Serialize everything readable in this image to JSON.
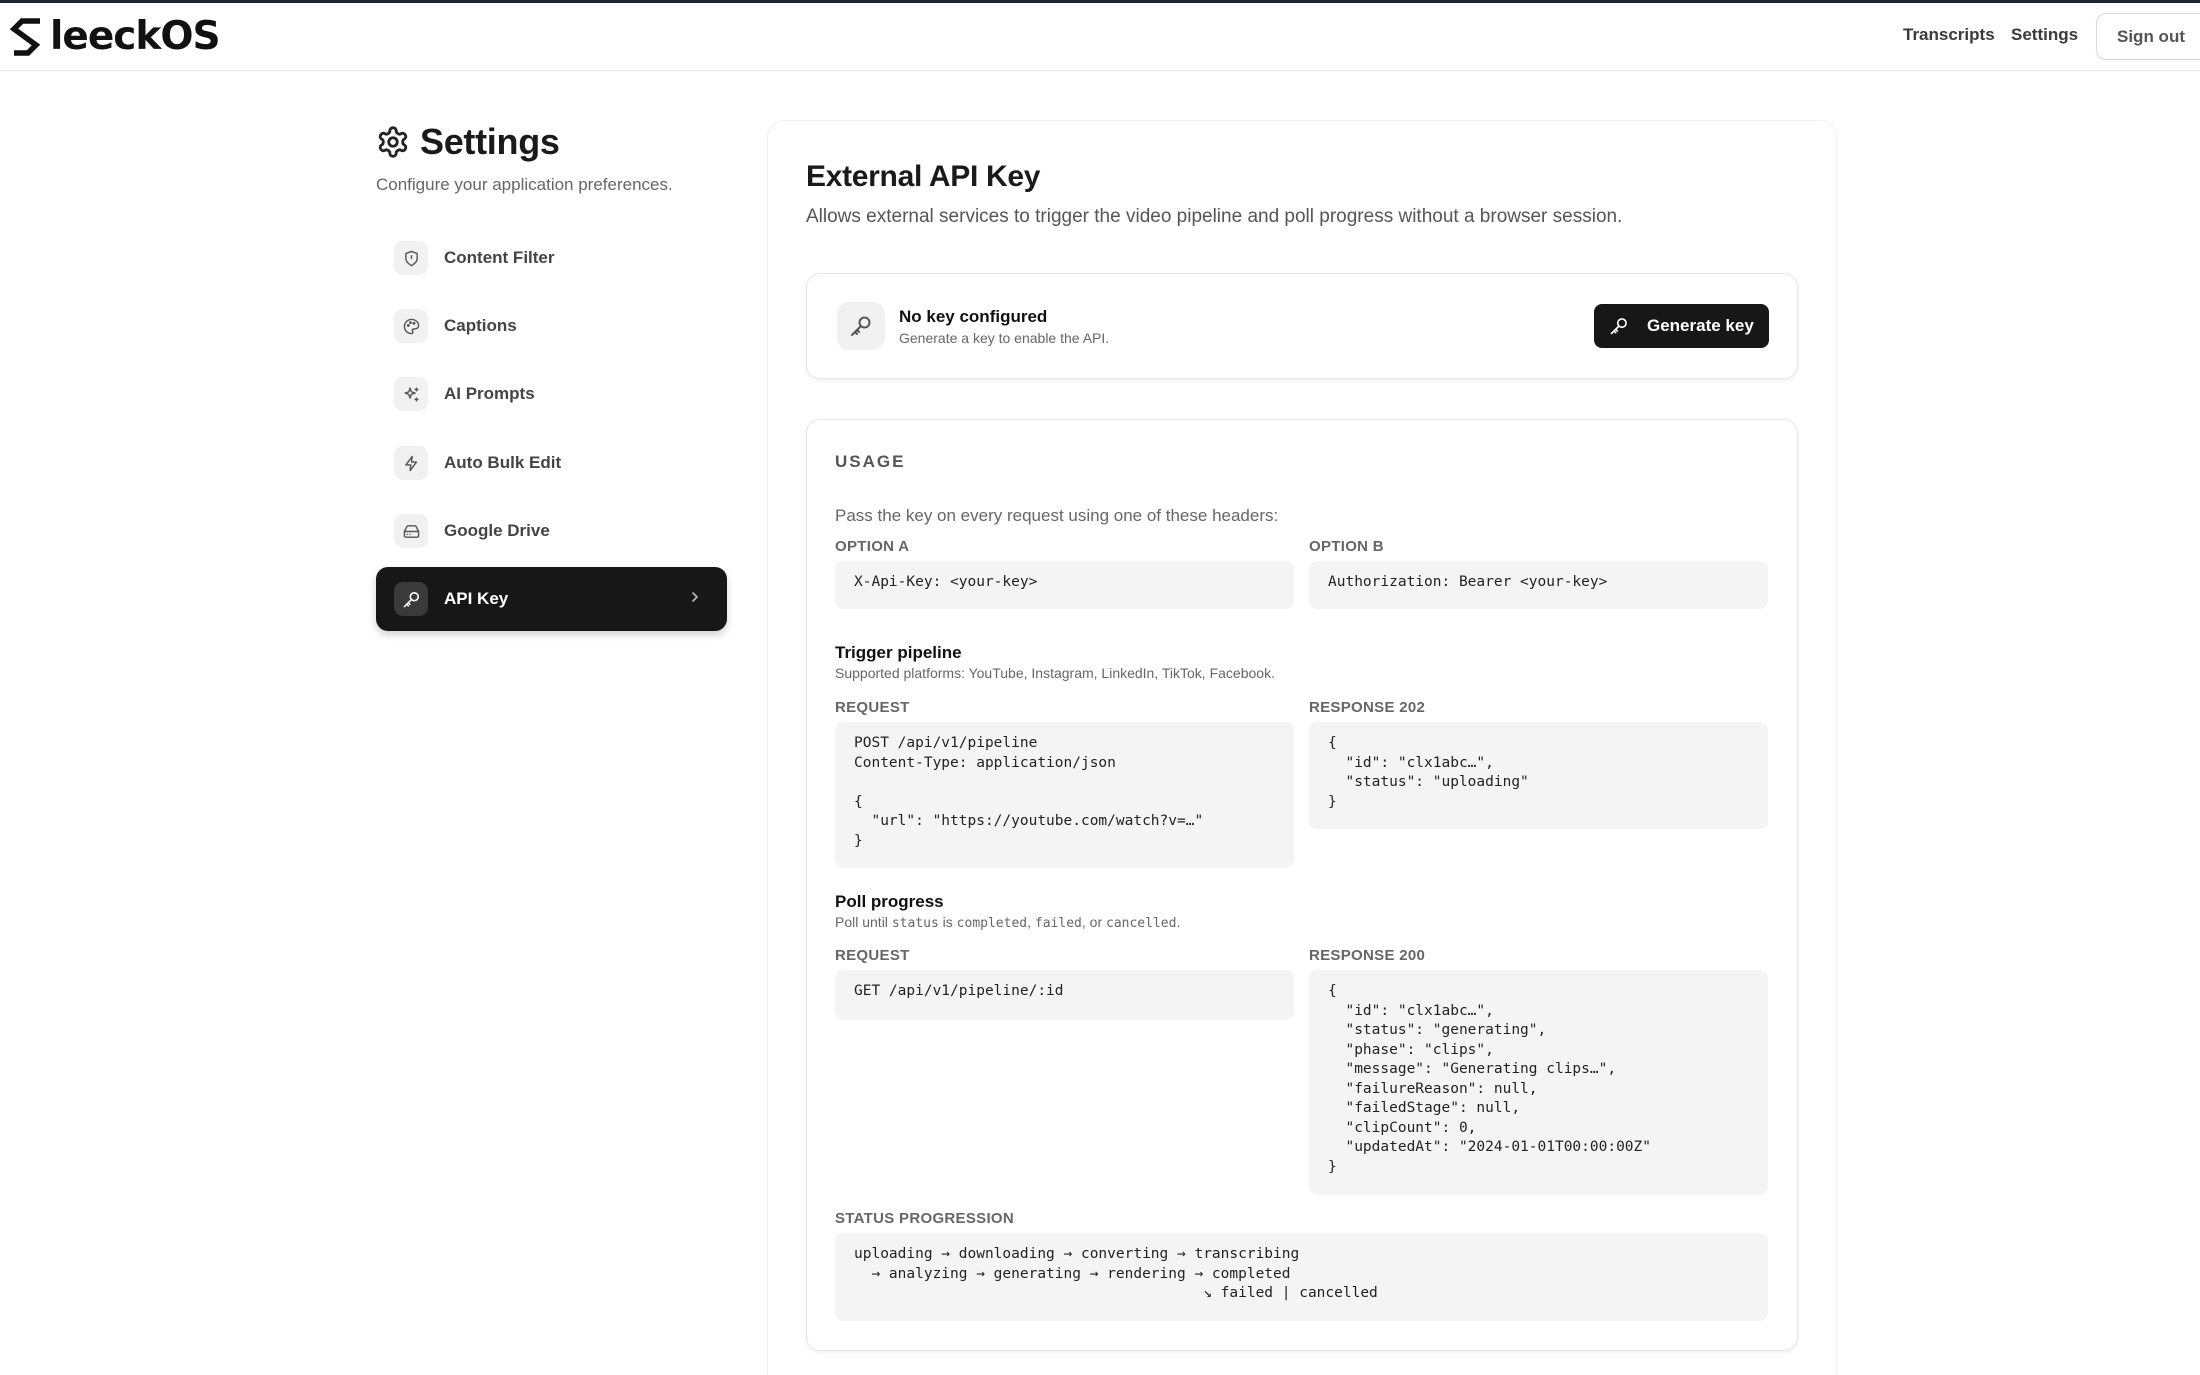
{
  "brand": {
    "logo_text": "leeckOS",
    "logo_letter": "S"
  },
  "nav": {
    "transcripts": "Transcripts",
    "settings": "Settings",
    "sign_out": "Sign out"
  },
  "sidebar": {
    "title": "Settings",
    "subtitle": "Configure your application preferences.",
    "items": [
      {
        "label": "Content Filter",
        "icon": "shield-icon"
      },
      {
        "label": "Captions",
        "icon": "palette-icon"
      },
      {
        "label": "AI Prompts",
        "icon": "sparkles-icon"
      },
      {
        "label": "Auto Bulk Edit",
        "icon": "zap-icon"
      },
      {
        "label": "Google Drive",
        "icon": "hard-drive-icon"
      },
      {
        "label": "API Key",
        "icon": "key-icon",
        "active": true
      }
    ]
  },
  "main": {
    "title": "External API Key",
    "description": "Allows external services to trigger the video pipeline and poll progress without a browser session.",
    "key_status": {
      "title": "No key configured",
      "subtitle": "Generate a key to enable the API.",
      "button": "Generate key"
    },
    "usage": {
      "heading": "USAGE",
      "intro": "Pass the key on every request using one of these headers:",
      "option_a_label": "OPTION A",
      "option_a_code": "X-Api-Key: <your-key>",
      "option_b_label": "OPTION B",
      "option_b_code": "Authorization: Bearer <your-key>",
      "trigger": {
        "title": "Trigger pipeline",
        "subtitle": "Supported platforms: YouTube, Instagram, LinkedIn, TikTok, Facebook.",
        "request_label": "REQUEST",
        "request_code": "POST /api/v1/pipeline\nContent-Type: application/json\n\n{\n  \"url\": \"https://youtube.com/watch?v=…\"\n}",
        "response_label": "RESPONSE 202",
        "response_code": "{\n  \"id\": \"clx1abc…\",\n  \"status\": \"uploading\"\n}"
      },
      "poll": {
        "title": "Poll progress",
        "subtitle_prefix": "Poll until ",
        "subtitle_status": "status",
        "subtitle_mid": " is ",
        "subtitle_completed": "completed",
        "subtitle_sep1": ", ",
        "subtitle_failed": "failed",
        "subtitle_sep2": ", or ",
        "subtitle_cancelled": "cancelled",
        "subtitle_end": ".",
        "request_label": "REQUEST",
        "request_code": "GET /api/v1/pipeline/:id",
        "response_label": "RESPONSE 200",
        "response_code": "{\n  \"id\": \"clx1abc…\",\n  \"status\": \"generating\",\n  \"phase\": \"clips\",\n  \"message\": \"Generating clips…\",\n  \"failureReason\": null,\n  \"failedStage\": null,\n  \"clipCount\": 0,\n  \"updatedAt\": \"2024-01-01T00:00:00Z\"\n}"
      },
      "status_label": "STATUS PROGRESSION",
      "status_code": "uploading → downloading → converting → transcribing\n  → analyzing → generating → rendering → completed\n                                        ↘ failed | cancelled"
    }
  }
}
